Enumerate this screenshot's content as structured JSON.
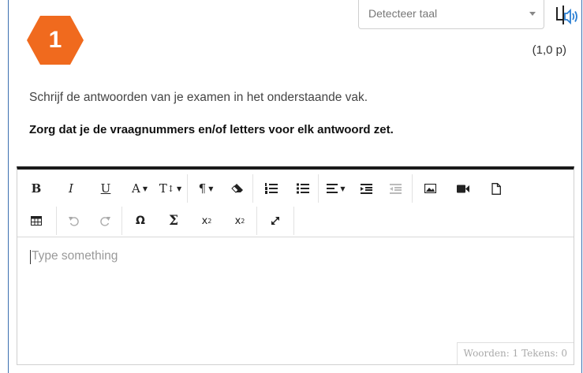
{
  "question": {
    "number": "1",
    "points": "(1,0 p)",
    "badge_color": "#f06a1e"
  },
  "language_select": {
    "value": "Detecteer taal"
  },
  "instructions": {
    "line1": "Schrijf de antwoorden van je examen in het onderstaande vak.",
    "line2": "Zorg dat je de vraagnummers en/of letters voor elk antwoord zet."
  },
  "toolbar": {
    "bold": "B",
    "italic": "I",
    "underline": "U",
    "font_color": "A",
    "font_size": "T",
    "paragraph": "¶",
    "special_char": "Ω",
    "formula": "Σ",
    "subscript_base": "x",
    "subscript_mark": "2",
    "superscript_base": "x",
    "superscript_mark": "2"
  },
  "editor": {
    "placeholder": "Type something",
    "word_count_label": "Woorden: 1 Tekens: 0"
  }
}
